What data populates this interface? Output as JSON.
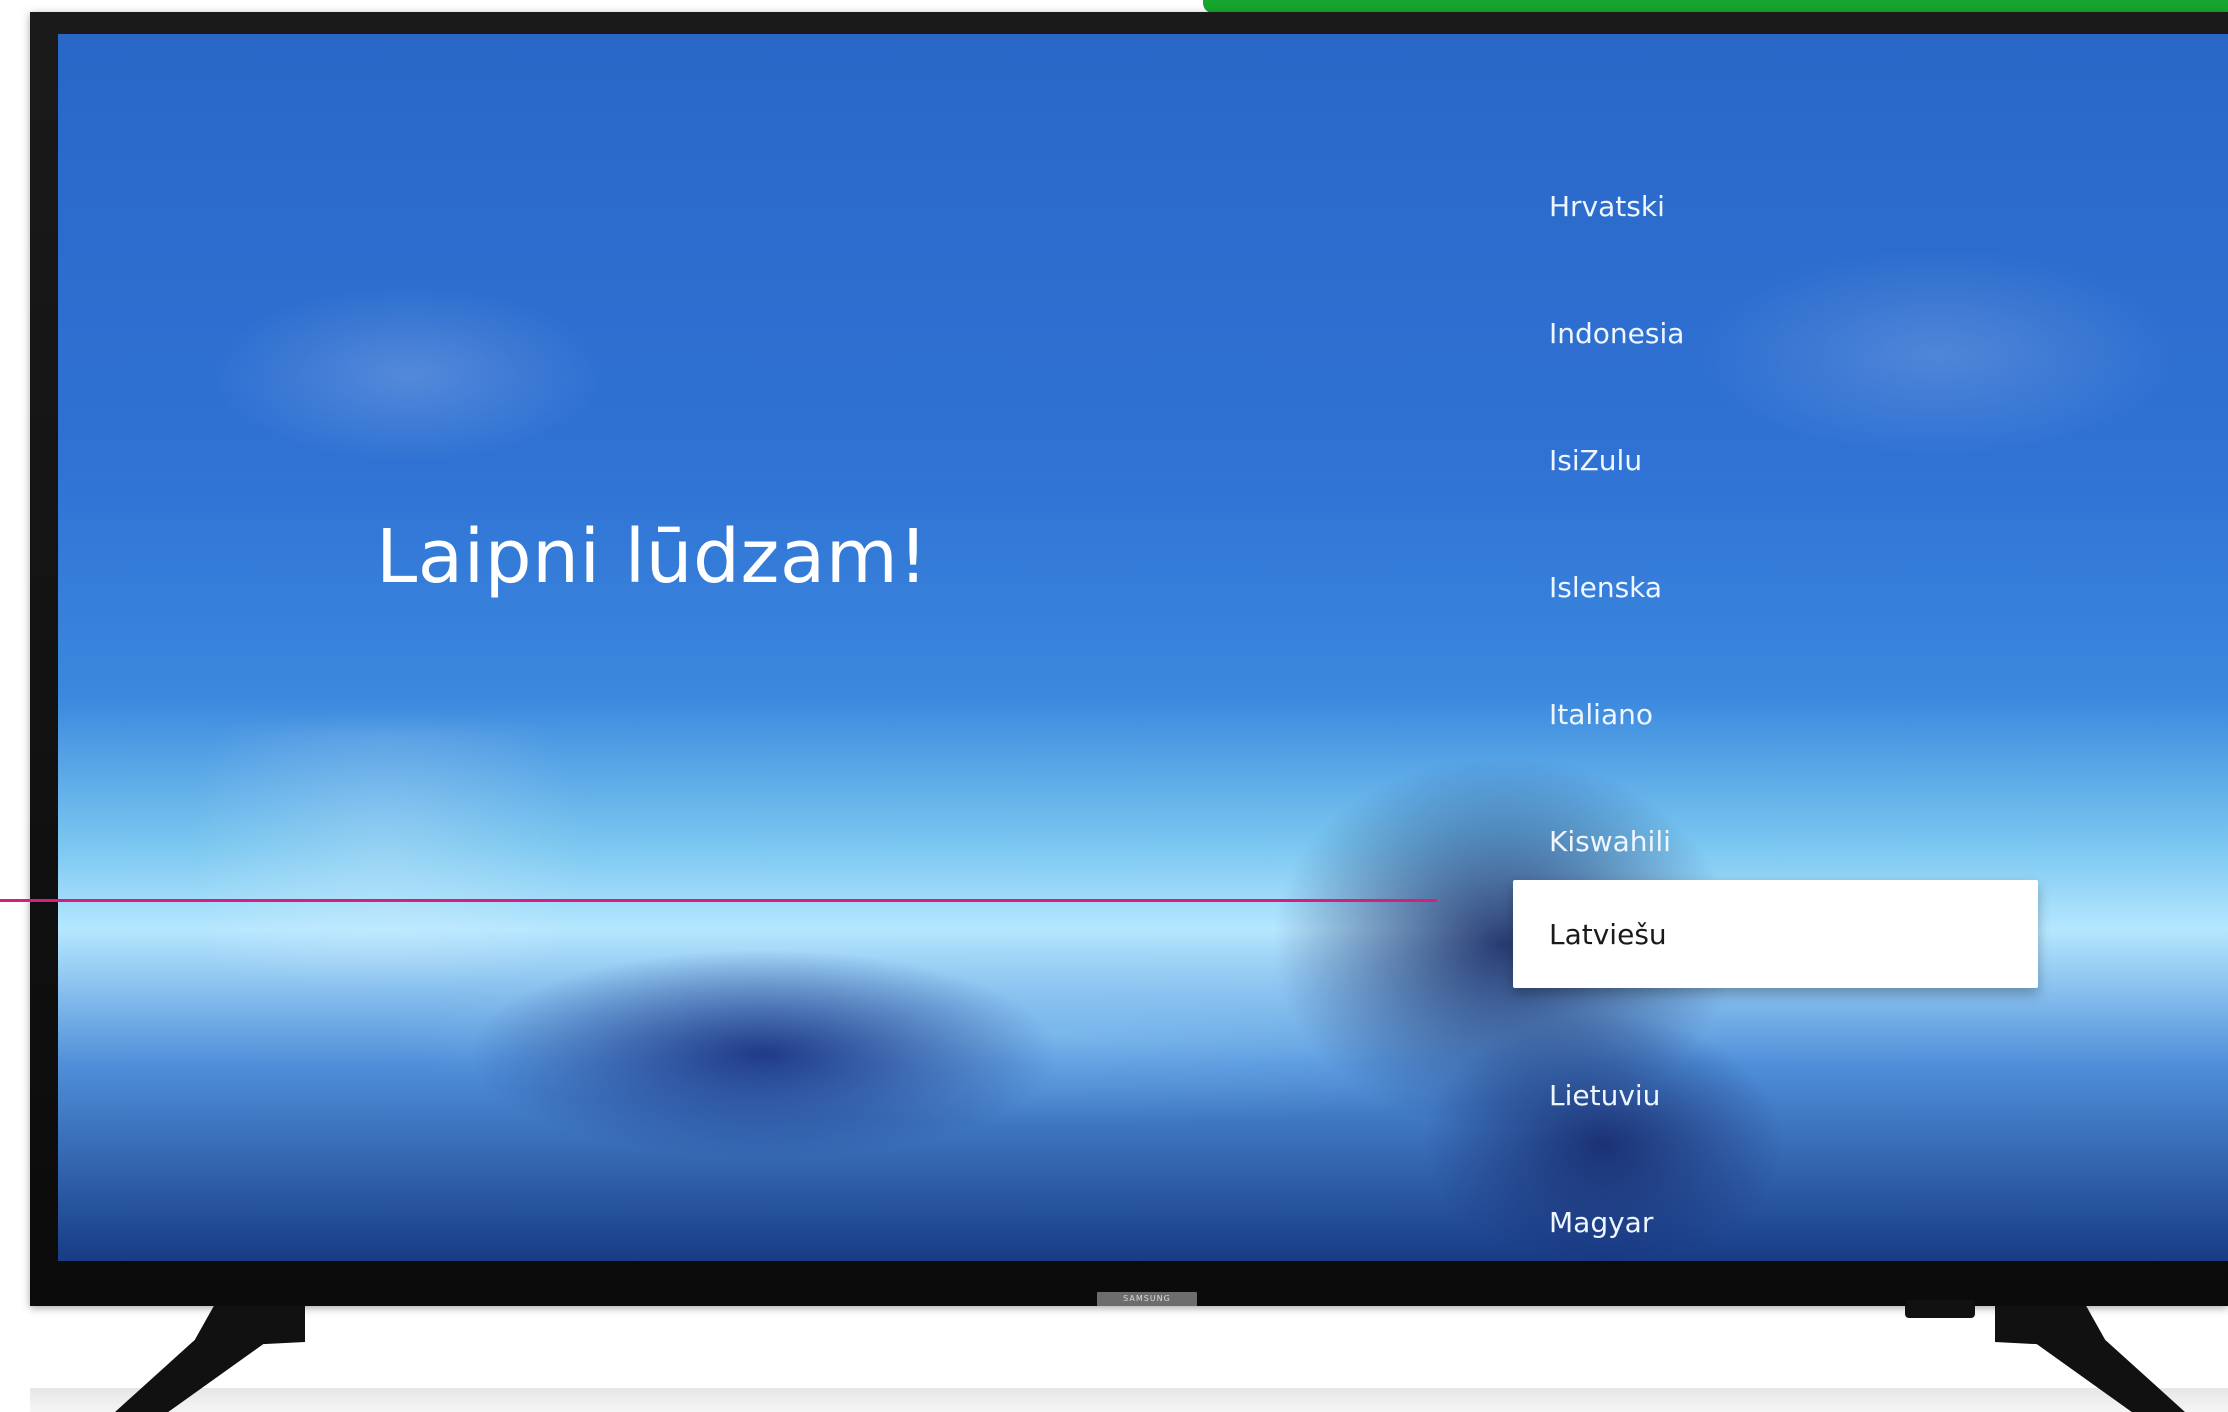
{
  "screen": {
    "title": "Laipni lūdzam!",
    "language_options": [
      {
        "label": "Hrvatski"
      },
      {
        "label": "Indonesia"
      },
      {
        "label": "IsiZulu"
      },
      {
        "label": "Islenska"
      },
      {
        "label": "Italiano"
      },
      {
        "label": "Kiswahili"
      },
      {
        "label": "Latviešu",
        "selected": true
      },
      {
        "label": "Lietuviu"
      },
      {
        "label": "Magyar"
      }
    ]
  },
  "tv": {
    "brand": "SAMSUNG"
  },
  "colors": {
    "accent_green": "#16a52e",
    "callout_magenta": "#d61f7a",
    "selection_background": "#ffffff"
  }
}
